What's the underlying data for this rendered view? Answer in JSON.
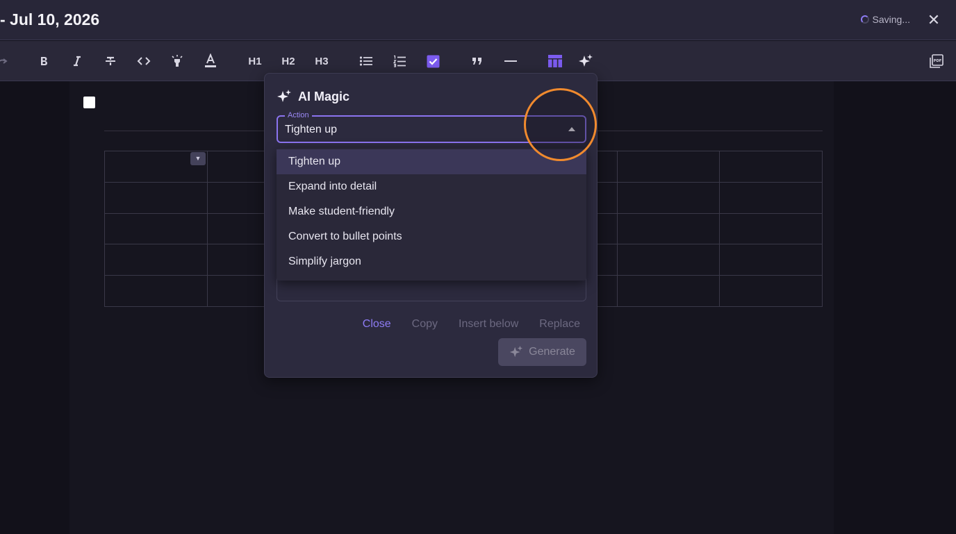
{
  "header": {
    "title": "- Jul 10, 2026",
    "status_text": "Saving...",
    "close_glyph": "✕"
  },
  "toolbar": {
    "h1": "H1",
    "h2": "H2",
    "h3": "H3",
    "icons": [
      "redo-icon",
      "bold-icon",
      "italic-icon",
      "strikethrough-icon",
      "code-icon",
      "highlight-icon",
      "text-color-icon",
      "bullet-list-icon",
      "numbered-list-icon",
      "task-list-icon",
      "blockquote-icon",
      "horizontal-rule-icon",
      "table-icon",
      "ai-magic-icon",
      "pdf-export-icon"
    ],
    "accent": "#8b74f0"
  },
  "ai_panel": {
    "title": "AI Magic",
    "action_label": "Action",
    "action_value": "Tighten up",
    "options": [
      "Tighten up",
      "Expand into detail",
      "Make student-friendly",
      "Convert to bullet points",
      "Simplify jargon"
    ],
    "buttons": {
      "close": "Close",
      "copy": "Copy",
      "insert_below": "Insert below",
      "replace": "Replace",
      "generate": "Generate"
    }
  },
  "colors": {
    "background": "#12111a",
    "panel": "#2c2a3e",
    "accent": "#8b74f0",
    "highlight": "#f08a2e"
  }
}
